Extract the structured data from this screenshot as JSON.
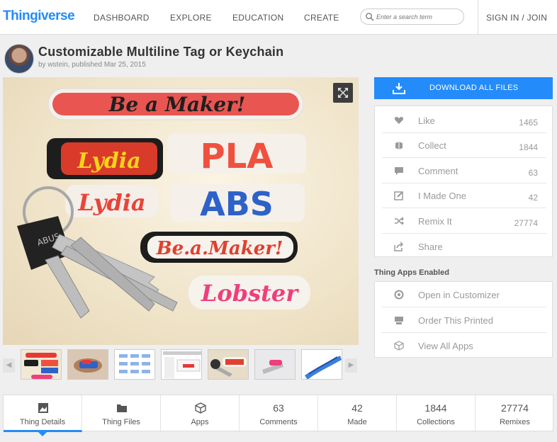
{
  "header": {
    "logo": "Thingiverse",
    "nav": [
      "DASHBOARD",
      "EXPLORE",
      "EDUCATION",
      "CREATE"
    ],
    "search_placeholder": "Enter a search term",
    "signin": "SIGN IN / JOIN"
  },
  "thing": {
    "title": "Customizable Multiline Tag or Keychain",
    "byline": "by wstein, published Mar 25, 2015"
  },
  "download": {
    "label": "DOWNLOAD ALL FILES"
  },
  "stats": [
    {
      "label": "Like",
      "count": "1465",
      "icon": "heart-icon"
    },
    {
      "label": "Collect",
      "count": "1844",
      "icon": "collect-icon"
    },
    {
      "label": "Comment",
      "count": "63",
      "icon": "comment-icon"
    },
    {
      "label": "I Made One",
      "count": "42",
      "icon": "made-icon"
    },
    {
      "label": "Remix It",
      "count": "27774",
      "icon": "remix-icon"
    },
    {
      "label": "Share",
      "count": "",
      "icon": "share-icon"
    }
  ],
  "apps": {
    "title": "Thing Apps Enabled",
    "items": [
      {
        "label": "Open in Customizer",
        "icon": "customizer-icon"
      },
      {
        "label": "Order This Printed",
        "icon": "printer-icon"
      },
      {
        "label": "View All Apps",
        "icon": "cube-icon"
      }
    ]
  },
  "image_text": {
    "tag1": "Be a Maker!",
    "tag2": "Lydia",
    "tag3": "PLA",
    "tag4": "Lydia",
    "tag5": "ABS",
    "tag6": "Be.a.Maker!",
    "tag7": "Lobster"
  },
  "tabs": [
    {
      "num": "",
      "label": "Thing Details",
      "icon": "details-icon"
    },
    {
      "num": "",
      "label": "Thing Files",
      "icon": "folder-icon"
    },
    {
      "num": "",
      "label": "Apps",
      "icon": "cube-icon"
    },
    {
      "num": "63",
      "label": "Comments"
    },
    {
      "num": "42",
      "label": "Made"
    },
    {
      "num": "1844",
      "label": "Collections"
    },
    {
      "num": "27774",
      "label": "Remixes"
    }
  ]
}
